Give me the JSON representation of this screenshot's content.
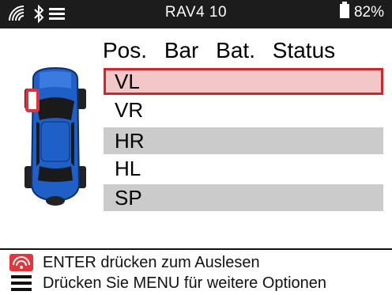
{
  "status_bar": {
    "title": "RAV4 10",
    "battery": "82%",
    "icons": [
      "wifi-icon",
      "bluetooth-icon",
      "menu-icon"
    ]
  },
  "table": {
    "headers": [
      "Pos.",
      "Bar",
      "Bat.",
      "Status"
    ],
    "rows": [
      {
        "position": "VL",
        "selected": true
      },
      {
        "position": "VR",
        "selected": false
      },
      {
        "position": "HR",
        "selected": false
      },
      {
        "position": "HL",
        "selected": false
      },
      {
        "position": "SP",
        "selected": false
      }
    ]
  },
  "footer": {
    "line1": "ENTER drücken zum Auslesen",
    "line2": "Drücken Sie MENU für weitere Optionen"
  },
  "colors": {
    "highlight_border": "#d0262c",
    "highlight_fill": "#f3c7c7",
    "car_body": "#1e5fc8",
    "selected_tire": "#e0303a"
  }
}
